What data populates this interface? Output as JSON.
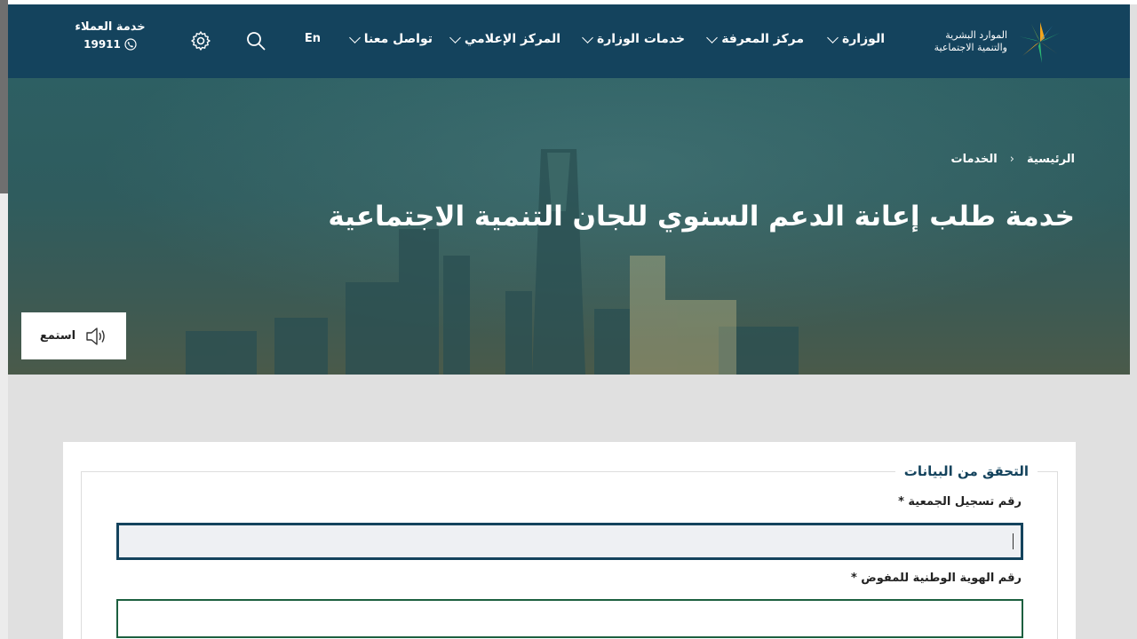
{
  "header": {
    "logo_line1": "الموارد البشرية",
    "logo_line2": "والتنمية الاجتماعية",
    "nav": [
      {
        "label": "الوزارة"
      },
      {
        "label": "مركز المعرفة"
      },
      {
        "label": "خدمات الوزارة"
      },
      {
        "label": "المركز الإعلامي"
      },
      {
        "label": "تواصل معنا"
      }
    ],
    "lang": "En",
    "customer_service_label": "خدمة العملاء",
    "customer_service_number": "19911"
  },
  "hero": {
    "breadcrumb": [
      "الرئيسية",
      "الخدمات"
    ],
    "breadcrumb_separator": "‹",
    "title": "خدمة طلب إعانة الدعم السنوي للجان التنمية الاجتماعية",
    "listen_label": "استمع"
  },
  "form": {
    "legend": "التحقق من البيانات",
    "field1_label": "رقم تسجيل الجمعية *",
    "field2_label": "رقم الهوية الوطنية للمفوض *"
  },
  "colors": {
    "header_bg": "#14435d",
    "accent_green": "#1c5f3f"
  }
}
